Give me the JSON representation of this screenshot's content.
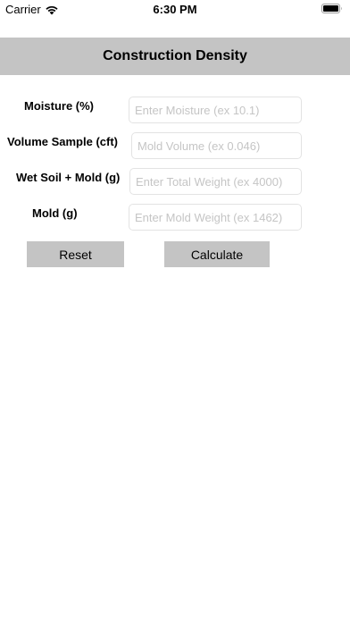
{
  "status_bar": {
    "carrier": "Carrier",
    "time": "6:30 PM"
  },
  "header": {
    "title": "Construction Density"
  },
  "form": {
    "moisture": {
      "label": "Moisture (%)",
      "placeholder": "Enter Moisture (ex 10.1)",
      "value": ""
    },
    "volume_sample": {
      "label": "Volume Sample (cft)",
      "placeholder": "Mold Volume (ex 0.046)",
      "value": ""
    },
    "wet_soil_mold": {
      "label": "Wet Soil + Mold (g)",
      "placeholder": "Enter Total Weight (ex 4000)",
      "value": ""
    },
    "mold": {
      "label": "Mold (g)",
      "placeholder": "Enter Mold Weight (ex 1462)",
      "value": ""
    }
  },
  "buttons": {
    "reset_label": "Reset",
    "calculate_label": "Calculate"
  },
  "colors": {
    "header_bg": "#c4c4c4",
    "button_bg": "#c4c4c4",
    "input_border": "#e3e3e3",
    "placeholder": "#c5c5c5"
  }
}
